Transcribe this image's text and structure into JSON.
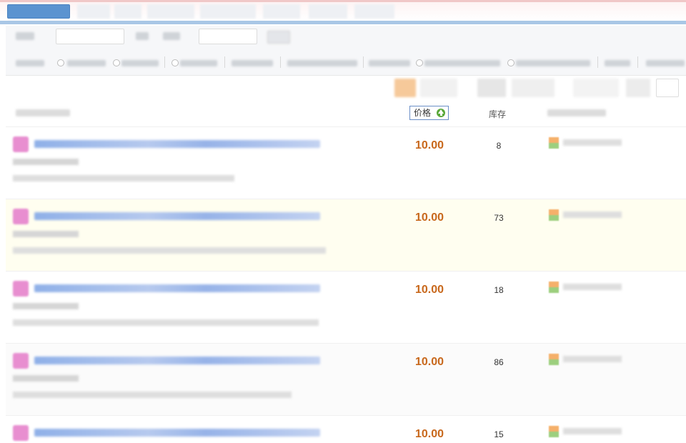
{
  "header": {
    "price_sort_label": "价格",
    "price_sort_icon": "arrow-up-icon",
    "stock_label": "库存"
  },
  "colors": {
    "price": "#c8681c",
    "active_tab": "#5b93d0",
    "highlight_row": "#fffef0",
    "sort_arrow": "#5aa83a"
  },
  "rows": [
    {
      "price": "10.00",
      "stock": "8",
      "highlighted": false
    },
    {
      "price": "10.00",
      "stock": "73",
      "highlighted": true
    },
    {
      "price": "10.00",
      "stock": "18",
      "highlighted": false
    },
    {
      "price": "10.00",
      "stock": "86",
      "highlighted": false
    },
    {
      "price": "10.00",
      "stock": "15",
      "highlighted": false
    }
  ]
}
